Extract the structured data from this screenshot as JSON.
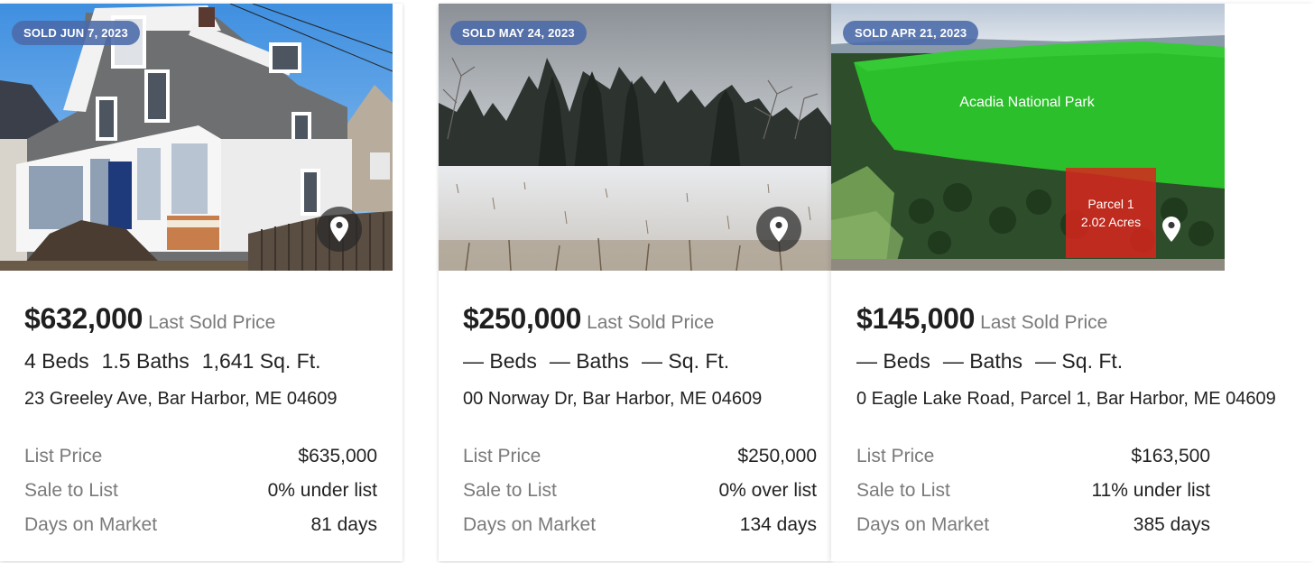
{
  "cards": [
    {
      "sold_badge": "SOLD JUN 7, 2023",
      "price": "$632,000",
      "price_label": "Last Sold Price",
      "beds": "4 Beds",
      "baths": "1.5 Baths",
      "sqft": "1,641 Sq. Ft.",
      "address": "23 Greeley Ave, Bar Harbor, ME 04609",
      "details": [
        {
          "label": "List Price",
          "value": "$635,000"
        },
        {
          "label": "Sale to List",
          "value": "0% under list"
        },
        {
          "label": "Days on Market",
          "value": "81 days"
        }
      ]
    },
    {
      "sold_badge": "SOLD MAY 24, 2023",
      "price": "$250,000",
      "price_label": "Last Sold Price",
      "beds": "— Beds",
      "baths": "— Baths",
      "sqft": "— Sq. Ft.",
      "address": "00 Norway Dr, Bar Harbor, ME 04609",
      "details": [
        {
          "label": "List Price",
          "value": "$250,000"
        },
        {
          "label": "Sale to List",
          "value": "0% over list"
        },
        {
          "label": "Days on Market",
          "value": "134 days"
        }
      ]
    },
    {
      "sold_badge": "SOLD APR 21, 2023",
      "price": "$145,000",
      "price_label": "Last Sold Price",
      "beds": "— Beds",
      "baths": "— Baths",
      "sqft": "— Sq. Ft.",
      "address": "0 Eagle Lake Road, Parcel 1, Bar Harbor, ME 04609",
      "photo_labels": {
        "park": "Acadia National Park",
        "parcel_line1": "Parcel 1",
        "parcel_line2": "2.02 Acres"
      },
      "details": [
        {
          "label": "List Price",
          "value": "$163,500"
        },
        {
          "label": "Sale to List",
          "value": "11% under list"
        },
        {
          "label": "Days on Market",
          "value": "385 days"
        }
      ]
    }
  ],
  "icons": {
    "map_pin": "map-pin-icon"
  },
  "colors": {
    "badge_bg": "#4b6aa8",
    "price_text": "#1f1f1f",
    "muted_text": "#7a7a7a",
    "parcel_red": "#d8261c",
    "forest_green": "#2bbf2b"
  }
}
